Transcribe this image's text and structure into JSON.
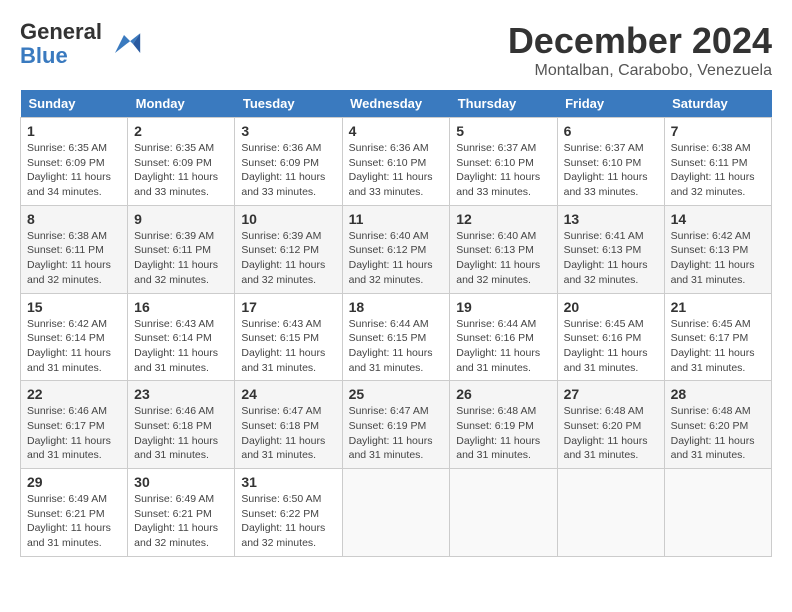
{
  "header": {
    "logo_line1": "General",
    "logo_line2": "Blue",
    "month_title": "December 2024",
    "location": "Montalban, Carabobo, Venezuela"
  },
  "days_of_week": [
    "Sunday",
    "Monday",
    "Tuesday",
    "Wednesday",
    "Thursday",
    "Friday",
    "Saturday"
  ],
  "weeks": [
    [
      {
        "day": "1",
        "sunrise": "6:35 AM",
        "sunset": "6:09 PM",
        "daylight": "11 hours and 34 minutes."
      },
      {
        "day": "2",
        "sunrise": "6:35 AM",
        "sunset": "6:09 PM",
        "daylight": "11 hours and 33 minutes."
      },
      {
        "day": "3",
        "sunrise": "6:36 AM",
        "sunset": "6:09 PM",
        "daylight": "11 hours and 33 minutes."
      },
      {
        "day": "4",
        "sunrise": "6:36 AM",
        "sunset": "6:10 PM",
        "daylight": "11 hours and 33 minutes."
      },
      {
        "day": "5",
        "sunrise": "6:37 AM",
        "sunset": "6:10 PM",
        "daylight": "11 hours and 33 minutes."
      },
      {
        "day": "6",
        "sunrise": "6:37 AM",
        "sunset": "6:10 PM",
        "daylight": "11 hours and 33 minutes."
      },
      {
        "day": "7",
        "sunrise": "6:38 AM",
        "sunset": "6:11 PM",
        "daylight": "11 hours and 32 minutes."
      }
    ],
    [
      {
        "day": "8",
        "sunrise": "6:38 AM",
        "sunset": "6:11 PM",
        "daylight": "11 hours and 32 minutes."
      },
      {
        "day": "9",
        "sunrise": "6:39 AM",
        "sunset": "6:11 PM",
        "daylight": "11 hours and 32 minutes."
      },
      {
        "day": "10",
        "sunrise": "6:39 AM",
        "sunset": "6:12 PM",
        "daylight": "11 hours and 32 minutes."
      },
      {
        "day": "11",
        "sunrise": "6:40 AM",
        "sunset": "6:12 PM",
        "daylight": "11 hours and 32 minutes."
      },
      {
        "day": "12",
        "sunrise": "6:40 AM",
        "sunset": "6:13 PM",
        "daylight": "11 hours and 32 minutes."
      },
      {
        "day": "13",
        "sunrise": "6:41 AM",
        "sunset": "6:13 PM",
        "daylight": "11 hours and 32 minutes."
      },
      {
        "day": "14",
        "sunrise": "6:42 AM",
        "sunset": "6:13 PM",
        "daylight": "11 hours and 31 minutes."
      }
    ],
    [
      {
        "day": "15",
        "sunrise": "6:42 AM",
        "sunset": "6:14 PM",
        "daylight": "11 hours and 31 minutes."
      },
      {
        "day": "16",
        "sunrise": "6:43 AM",
        "sunset": "6:14 PM",
        "daylight": "11 hours and 31 minutes."
      },
      {
        "day": "17",
        "sunrise": "6:43 AM",
        "sunset": "6:15 PM",
        "daylight": "11 hours and 31 minutes."
      },
      {
        "day": "18",
        "sunrise": "6:44 AM",
        "sunset": "6:15 PM",
        "daylight": "11 hours and 31 minutes."
      },
      {
        "day": "19",
        "sunrise": "6:44 AM",
        "sunset": "6:16 PM",
        "daylight": "11 hours and 31 minutes."
      },
      {
        "day": "20",
        "sunrise": "6:45 AM",
        "sunset": "6:16 PM",
        "daylight": "11 hours and 31 minutes."
      },
      {
        "day": "21",
        "sunrise": "6:45 AM",
        "sunset": "6:17 PM",
        "daylight": "11 hours and 31 minutes."
      }
    ],
    [
      {
        "day": "22",
        "sunrise": "6:46 AM",
        "sunset": "6:17 PM",
        "daylight": "11 hours and 31 minutes."
      },
      {
        "day": "23",
        "sunrise": "6:46 AM",
        "sunset": "6:18 PM",
        "daylight": "11 hours and 31 minutes."
      },
      {
        "day": "24",
        "sunrise": "6:47 AM",
        "sunset": "6:18 PM",
        "daylight": "11 hours and 31 minutes."
      },
      {
        "day": "25",
        "sunrise": "6:47 AM",
        "sunset": "6:19 PM",
        "daylight": "11 hours and 31 minutes."
      },
      {
        "day": "26",
        "sunrise": "6:48 AM",
        "sunset": "6:19 PM",
        "daylight": "11 hours and 31 minutes."
      },
      {
        "day": "27",
        "sunrise": "6:48 AM",
        "sunset": "6:20 PM",
        "daylight": "11 hours and 31 minutes."
      },
      {
        "day": "28",
        "sunrise": "6:48 AM",
        "sunset": "6:20 PM",
        "daylight": "11 hours and 31 minutes."
      }
    ],
    [
      {
        "day": "29",
        "sunrise": "6:49 AM",
        "sunset": "6:21 PM",
        "daylight": "11 hours and 31 minutes."
      },
      {
        "day": "30",
        "sunrise": "6:49 AM",
        "sunset": "6:21 PM",
        "daylight": "11 hours and 32 minutes."
      },
      {
        "day": "31",
        "sunrise": "6:50 AM",
        "sunset": "6:22 PM",
        "daylight": "11 hours and 32 minutes."
      },
      null,
      null,
      null,
      null
    ]
  ],
  "labels": {
    "sunrise_prefix": "Sunrise: ",
    "sunset_prefix": "Sunset: ",
    "daylight_prefix": "Daylight: "
  }
}
